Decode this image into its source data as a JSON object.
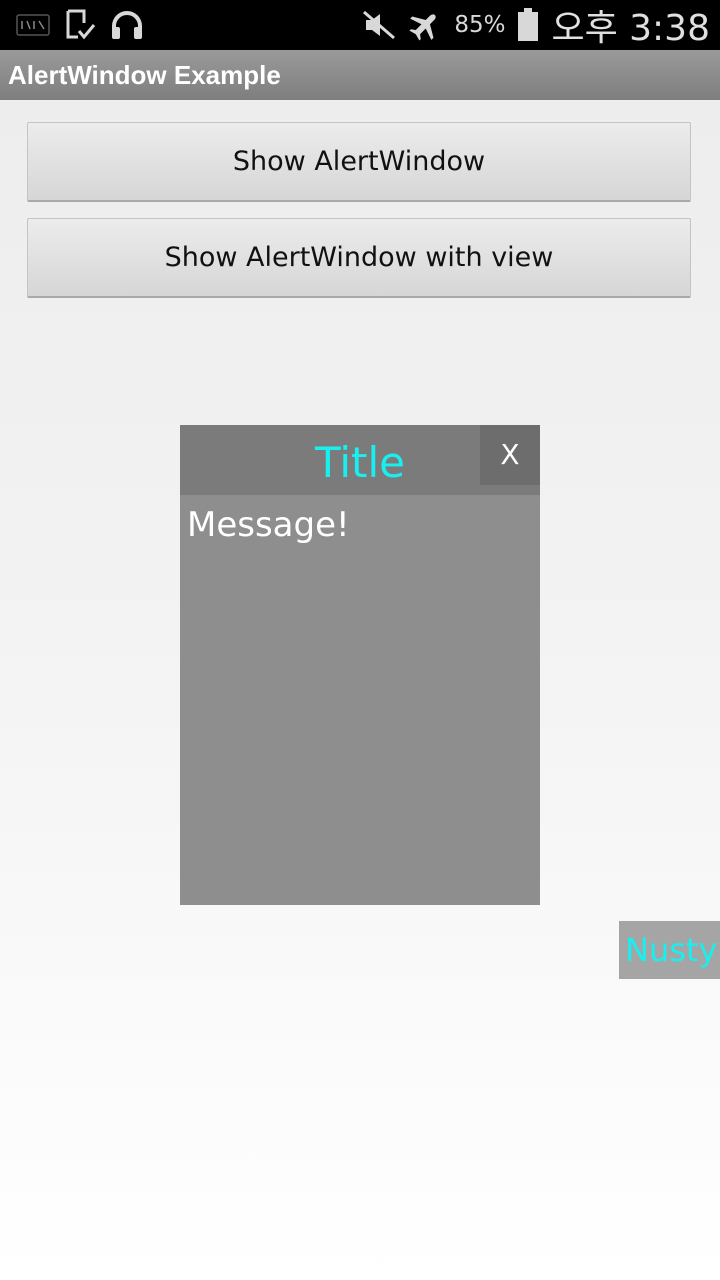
{
  "status_bar": {
    "left_icons": [
      "nate-icon",
      "download-done-icon",
      "headphones-icon"
    ],
    "right_icons": [
      "mute-icon",
      "airplane-mode-icon",
      "battery-icon"
    ],
    "battery_percent": "85%",
    "time": "오후 3:38"
  },
  "action_bar": {
    "title": "AlertWindow Example"
  },
  "buttons": {
    "show_alert": "Show AlertWindow",
    "show_alert_view": "Show AlertWindow with view"
  },
  "alert_window": {
    "title": "Title",
    "close_label": "X",
    "message": "Message!"
  },
  "floating_tag": {
    "label": "Nusty"
  },
  "colors": {
    "accent_cyan": "#18f0f0",
    "alert_body": "#8e8e8e",
    "alert_header": "#7b7b7b",
    "close_button": "#6d6d6d"
  }
}
